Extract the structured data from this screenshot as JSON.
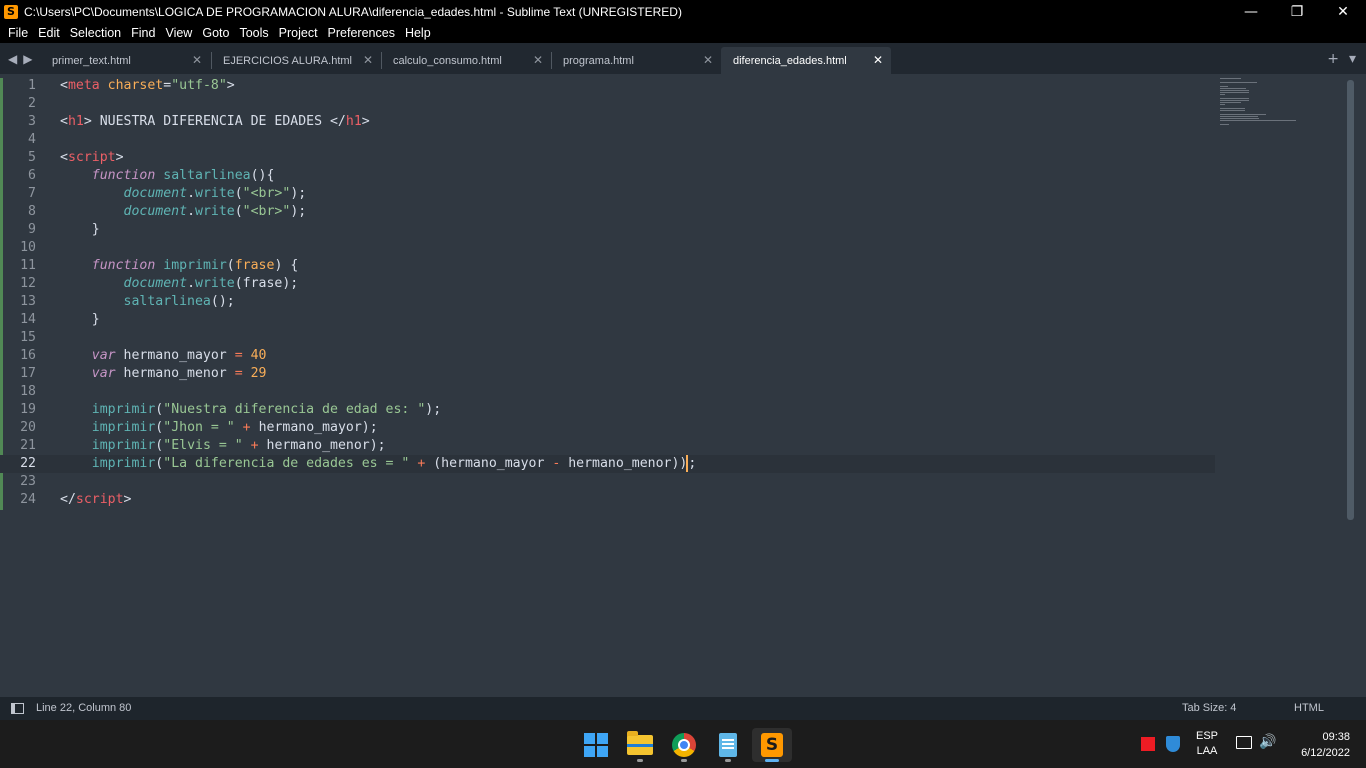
{
  "window": {
    "title": "C:\\Users\\PC\\Documents\\LOGICA DE PROGRAMACION ALURA\\diferencia_edades.html - Sublime Text (UNREGISTERED)",
    "minimize": "—",
    "maximize": "❐",
    "close": "✕"
  },
  "menu": [
    "File",
    "Edit",
    "Selection",
    "Find",
    "View",
    "Goto",
    "Tools",
    "Project",
    "Preferences",
    "Help"
  ],
  "tabs": [
    {
      "label": "primer_text.html",
      "active": false
    },
    {
      "label": "EJERCICIOS ALURA.html",
      "active": false
    },
    {
      "label": "calculo_consumo.html",
      "active": false
    },
    {
      "label": "programa.html",
      "active": false
    },
    {
      "label": "diferencia_edades.html",
      "active": true
    }
  ],
  "tab_close_glyph": "✕",
  "editor": {
    "current_line": 22,
    "lines": [
      {
        "n": "1",
        "html": "<span class='pu'>&lt;</span><span class='tg'>meta</span> <span class='at'>charset</span><span class='pu'>=</span><span class='st'>\"utf-8\"</span><span class='pu'>&gt;</span>"
      },
      {
        "n": "2",
        "html": ""
      },
      {
        "n": "3",
        "html": "<span class='pu'>&lt;</span><span class='tg'>h1</span><span class='pu'>&gt;</span> NUESTRA DIFERENCIA DE EDADES <span class='pu'>&lt;/</span><span class='tg'>h1</span><span class='pu'>&gt;</span>"
      },
      {
        "n": "4",
        "html": ""
      },
      {
        "n": "5",
        "html": "<span class='pu'>&lt;</span><span class='tg'>script</span><span class='pu'>&gt;</span>"
      },
      {
        "n": "6",
        "html": "    <span class='kw'>function</span> <span class='fn'>saltarlinea</span>(){"
      },
      {
        "n": "7",
        "html": "        <span class='it'>document</span>.<span class='fn'>write</span>(<span class='st'>\"&lt;br&gt;\"</span>);"
      },
      {
        "n": "8",
        "html": "        <span class='it'>document</span>.<span class='fn'>write</span>(<span class='st'>\"&lt;br&gt;\"</span>);"
      },
      {
        "n": "9",
        "html": "    }"
      },
      {
        "n": "10",
        "html": ""
      },
      {
        "n": "11",
        "html": "    <span class='kw'>function</span> <span class='fn'>imprimir</span>(<span class='pr'>frase</span>) {"
      },
      {
        "n": "12",
        "html": "        <span class='it'>document</span>.<span class='fn'>write</span>(frase);"
      },
      {
        "n": "13",
        "html": "        <span class='fn'>saltarlinea</span>();"
      },
      {
        "n": "14",
        "html": "    }"
      },
      {
        "n": "15",
        "html": ""
      },
      {
        "n": "16",
        "html": "    <span class='kw'>var</span> hermano_mayor <span class='op'>=</span> <span class='nu'>40</span>"
      },
      {
        "n": "17",
        "html": "    <span class='kw'>var</span> hermano_menor <span class='op'>=</span> <span class='nu'>29</span>"
      },
      {
        "n": "18",
        "html": ""
      },
      {
        "n": "19",
        "html": "    <span class='fn'>imprimir</span>(<span class='st'>\"Nuestra diferencia de edad es: \"</span>);"
      },
      {
        "n": "20",
        "html": "    <span class='fn'>imprimir</span>(<span class='st'>\"Jhon = \"</span> <span class='op'>+</span> hermano_mayor);"
      },
      {
        "n": "21",
        "html": "    <span class='fn'>imprimir</span>(<span class='st'>\"Elvis = \"</span> <span class='op'>+</span> hermano_menor);"
      },
      {
        "n": "22",
        "html": "    <span class='fn'>imprimir</span>(<span class='st'>\"La diferencia de edades es = \"</span> <span class='op'>+</span> (hermano_mayor <span class='op'>-</span> hermano_menor))<span class='cursor'></span>;"
      },
      {
        "n": "23",
        "html": ""
      },
      {
        "n": "24",
        "html": "<span class='pu'>&lt;/</span><span class='tg'>script</span><span class='pu'>&gt;</span>"
      }
    ]
  },
  "status": {
    "position": "Line 22, Column 80",
    "tab_size": "Tab Size: 4",
    "syntax": "HTML"
  },
  "taskbar": {
    "apps": [
      "start-menu",
      "file-explorer",
      "chrome",
      "notepad",
      "sublime-text"
    ],
    "sublime_glyph": "S",
    "language": "ESP",
    "layout": "LAA",
    "time": "09:38",
    "date": "6/12/2022",
    "volume_glyph": "🔊"
  }
}
